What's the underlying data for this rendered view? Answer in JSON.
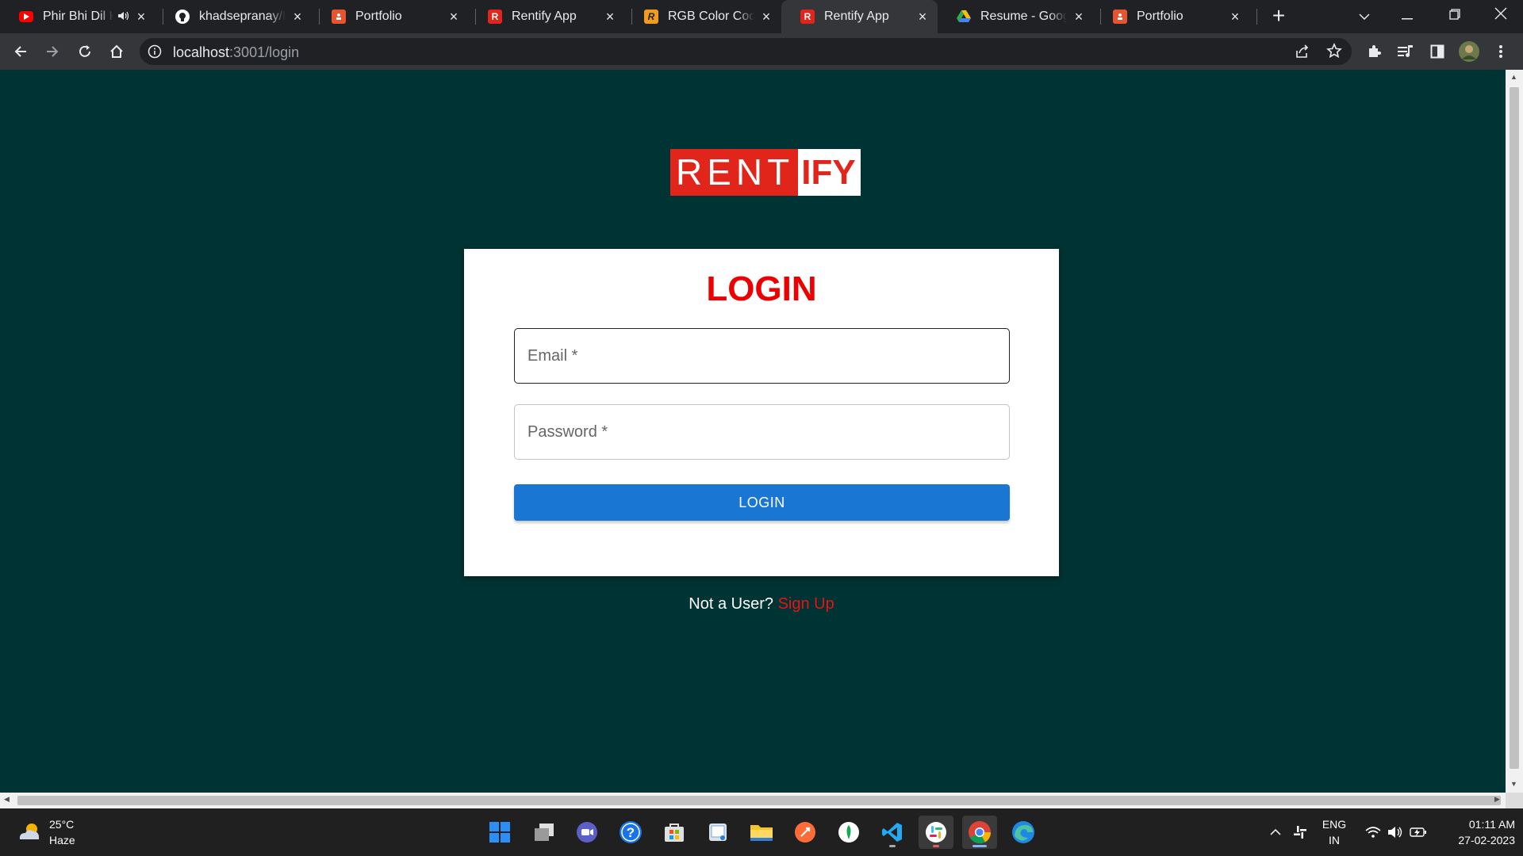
{
  "browser": {
    "tabs": [
      {
        "title": "Phir Bhi Dil H",
        "favicon": "youtube-icon",
        "color": "#ff0000",
        "muted": true,
        "active": false
      },
      {
        "title": "khadsepranay/Re",
        "favicon": "github-icon",
        "color": "#ffffff",
        "active": false
      },
      {
        "title": "Portfolio",
        "favicon": "portfolio-icon",
        "color": "#e8542f",
        "active": false
      },
      {
        "title": "Rentify App",
        "favicon": "rentify-icon",
        "color": "#e1251b",
        "letter": "R",
        "active": false
      },
      {
        "title": "RGB Color Codes",
        "favicon": "rgb-icon",
        "color": "#f29b1d",
        "letter": "R",
        "active": false
      },
      {
        "title": "Rentify App",
        "favicon": "rentify-icon",
        "color": "#e1251b",
        "letter": "R",
        "active": true
      },
      {
        "title": "Resume - Google",
        "favicon": "google-drive-icon",
        "color": "#34a853",
        "active": false
      },
      {
        "title": "Portfolio",
        "favicon": "portfolio-icon",
        "color": "#e8542f",
        "active": false
      }
    ],
    "address": {
      "host": "localhost",
      "path": ":3001/login"
    }
  },
  "page": {
    "logo": {
      "part1": "RENT",
      "part2": "IFY"
    },
    "login_title": "LOGIN",
    "email": {
      "placeholder": "Email *",
      "value": ""
    },
    "password": {
      "placeholder": "Password *",
      "value": ""
    },
    "login_button": "LOGIN",
    "signup_prompt": "Not a User?",
    "signup_link": "Sign Up"
  },
  "colors": {
    "page_bg": "#003333",
    "accent_red": "#ee0000",
    "button_blue": "#1976d2"
  },
  "taskbar": {
    "weather": {
      "temp": "25°C",
      "condition": "Haze"
    },
    "apps": [
      "windows-start-icon",
      "task-view-icon",
      "teams-chat-icon",
      "help-icon",
      "store-icon",
      "snipping-icon",
      "file-explorer-icon",
      "postman-icon",
      "mongodb-compass-icon",
      "vscode-icon",
      "slack-icon",
      "chrome-icon",
      "edge-icon"
    ],
    "language": {
      "line1": "ENG",
      "line2": "IN"
    },
    "time": "01:11 AM",
    "date": "27-02-2023"
  }
}
